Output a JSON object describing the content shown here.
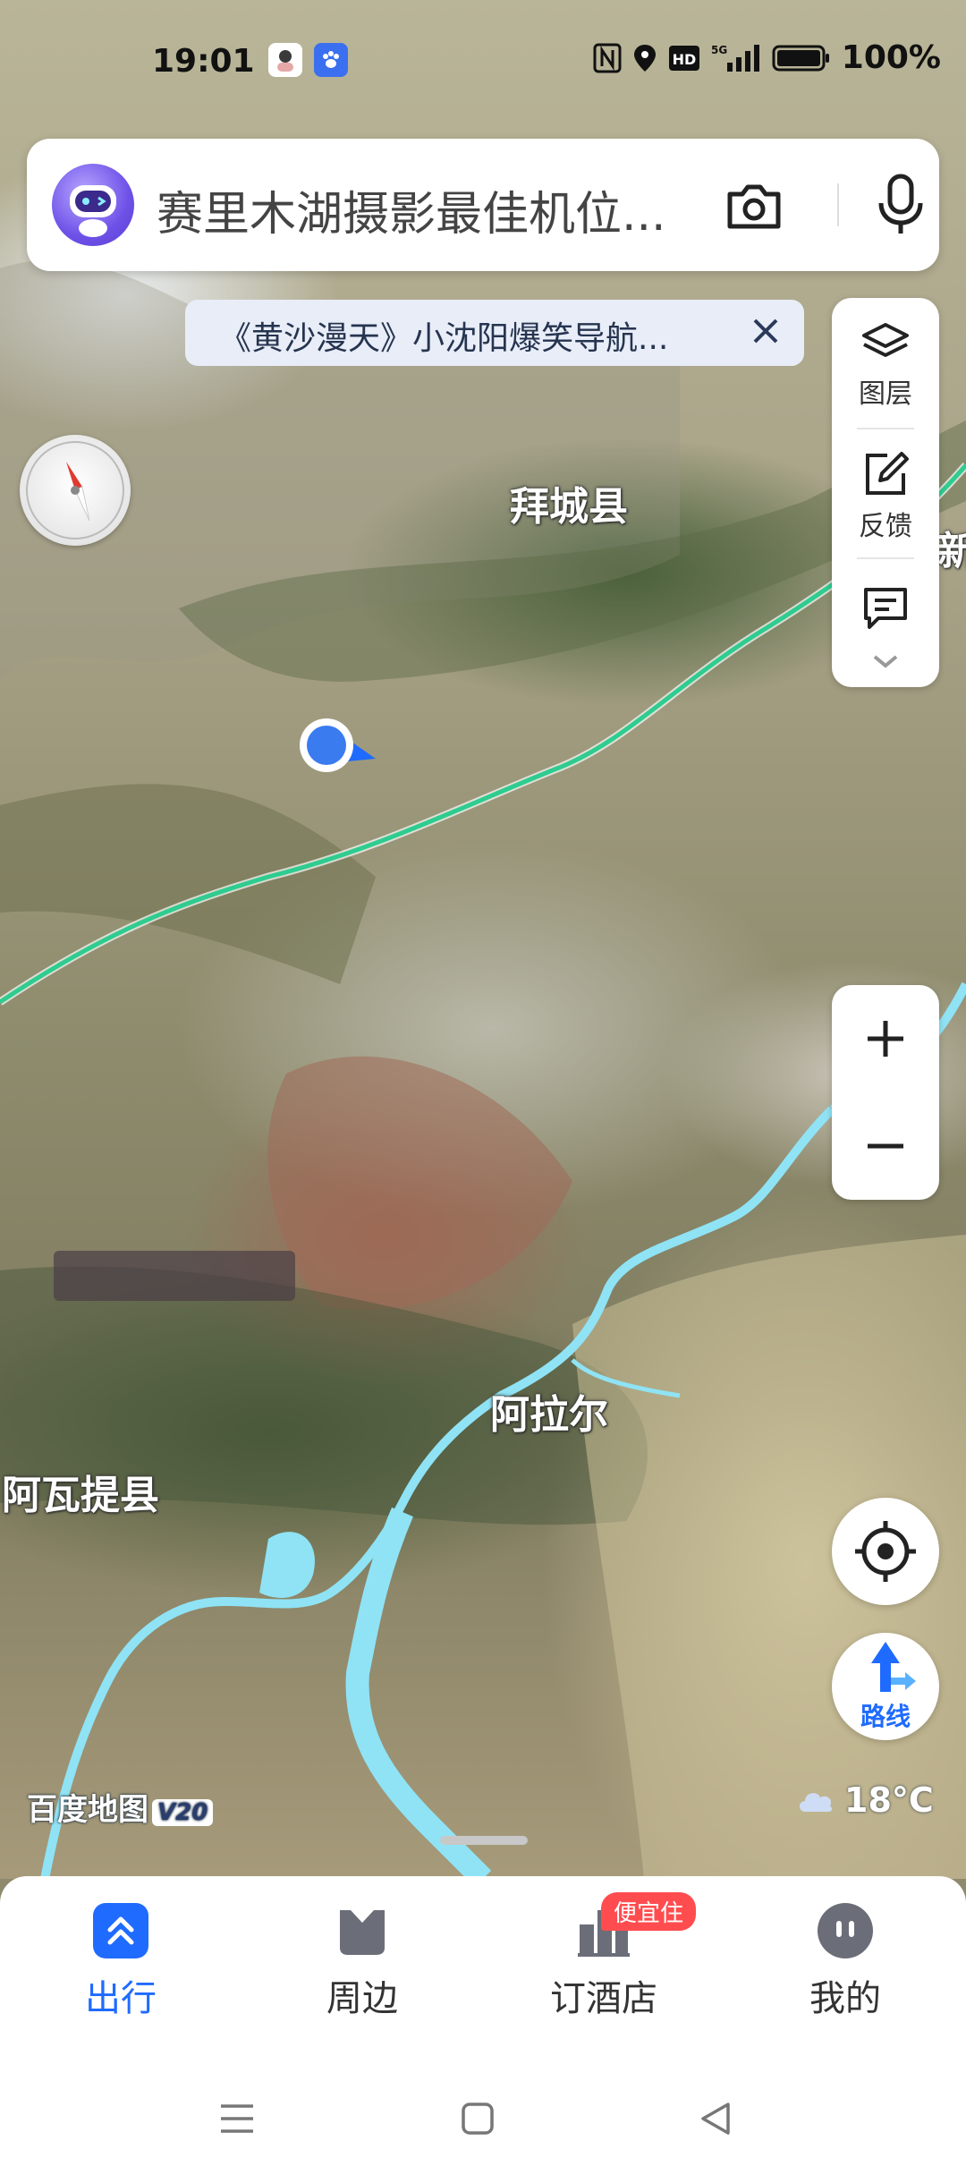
{
  "status_bar": {
    "time": "19:01",
    "battery_percent": "100%",
    "signal": "5G",
    "icons": [
      "avatar-app-icon",
      "baidu-app-icon",
      "nfc-icon",
      "location-icon",
      "hd-icon",
      "signal-icon",
      "battery-icon"
    ]
  },
  "search": {
    "text": "赛里木湖摄影最佳机位...",
    "left_icon": "assistant-robot-icon",
    "right_icons": [
      "camera-icon",
      "microphone-icon"
    ]
  },
  "notice": {
    "text": "《黄沙漫天》小沈阳爆笑导航...",
    "close_icon": "close-icon"
  },
  "tools": [
    {
      "label": "图层",
      "icon": "layers-icon"
    },
    {
      "label": "反馈",
      "icon": "edit-feedback-icon"
    },
    {
      "label": "",
      "icon": "message-icon"
    }
  ],
  "map": {
    "labels": {
      "baicheng": "拜城县",
      "xin": "新",
      "alaer": "阿拉尔",
      "awati": "阿瓦提县"
    },
    "user_location": "current-location-dot",
    "colors": {
      "river": "#8fe3f5",
      "highway": "#2ecc8f"
    }
  },
  "zoom": {
    "in_icon": "plus-icon",
    "out_icon": "minus-icon"
  },
  "locate_icon": "crosshair-icon",
  "route": {
    "label": "路线",
    "icon": "route-arrow-icon"
  },
  "brand": {
    "name": "百度地图",
    "version": "V20"
  },
  "weather": {
    "temperature": "18°C",
    "icon": "cloud-icon"
  },
  "bottom_nav": {
    "items": [
      {
        "label": "出行",
        "icon": "travel-icon",
        "active": true
      },
      {
        "label": "周边",
        "icon": "nearby-icon",
        "active": false
      },
      {
        "label": "订酒店",
        "icon": "hotel-icon",
        "active": false
      },
      {
        "label": "我的",
        "icon": "profile-icon",
        "active": false
      }
    ],
    "hotel_badge": "便宜住"
  },
  "theme": {
    "accent": "#1f6bff",
    "badge": "#ff4d4f"
  }
}
